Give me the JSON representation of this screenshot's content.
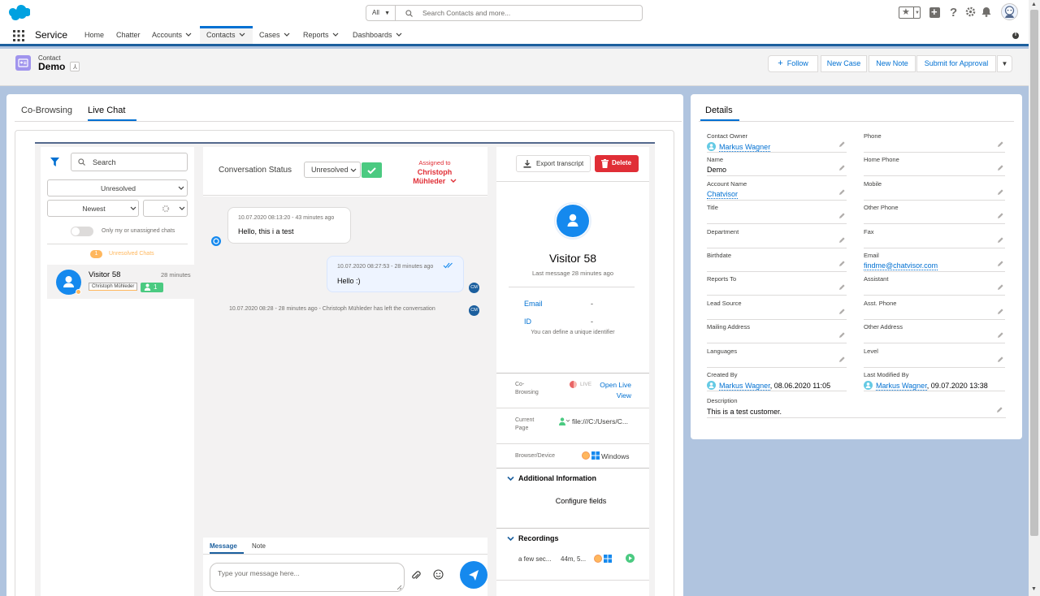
{
  "header": {
    "search_scope": "All",
    "search_placeholder": "Search Contacts and more..."
  },
  "nav": {
    "app_name": "Service",
    "items": [
      {
        "label": "Home"
      },
      {
        "label": "Chatter"
      },
      {
        "label": "Accounts"
      },
      {
        "label": "Contacts"
      },
      {
        "label": "Cases"
      },
      {
        "label": "Reports"
      },
      {
        "label": "Dashboards"
      }
    ]
  },
  "record": {
    "type": "Contact",
    "name": "Demo",
    "actions": {
      "follow": "Follow",
      "new_case": "New Case",
      "new_note": "New Note",
      "submit": "Submit for Approval"
    }
  },
  "tabs": {
    "cobrowsing": "Co-Browsing",
    "livechat": "Live Chat"
  },
  "chat_list": {
    "search_placeholder": "Search",
    "status_filter": "Unresolved",
    "sort": "Newest",
    "toggle_label": "Only my or unassigned chats",
    "unresolved_count": "1",
    "unresolved_label": "Unresolved Chats",
    "item": {
      "name": "Visitor 58",
      "time": "28 minutes",
      "agent": "Christoph Mühleder",
      "badge": "1"
    }
  },
  "conversation": {
    "status_label": "Conversation Status",
    "status_value": "Unresolved",
    "assigned_label": "Assigned to",
    "assigned_name_line1": "Christoph",
    "assigned_name_line2": "Mühleder",
    "messages": [
      {
        "time": "10.07.2020 08:13:20 - 43 minutes ago",
        "text": "Hello, this i a test"
      },
      {
        "time": "10.07.2020 08:27:53 - 28 minutes ago",
        "text": "Hello :)",
        "avatar": "CM"
      }
    ],
    "system_message": "10.07.2020 08:28 - 28 minutes ago - Christoph Mühleder has left the conversation",
    "system_avatar": "CM",
    "compose_tabs": {
      "message": "Message",
      "note": "Note"
    },
    "compose_placeholder": "Type your message here..."
  },
  "visitor": {
    "export_label": "Export transcript",
    "delete_label": "Delete",
    "name": "Visitor 58",
    "last_message": "Last message 28 minutes ago",
    "email_label": "Email",
    "email_value": "-",
    "id_label": "ID",
    "id_value": "-",
    "id_hint": "You can define a unique identifier",
    "cobrowsing_label_1": "Co-",
    "cobrowsing_label_2": "Browsing",
    "live_label": "LIVE",
    "open_live_1": "Open Live",
    "open_live_2": "View",
    "current_page_label_1": "Current",
    "current_page_label_2": "Page",
    "current_page_value": "file:///C:/Users/C...",
    "browser_label": "Browser/Device",
    "browser_value": "Windows",
    "additional_info": "Additional Information",
    "configure_fields": "Configure fields",
    "recordings": "Recordings",
    "rec_time": "a few sec...",
    "rec_duration": "44m, 5..."
  },
  "details": {
    "tab": "Details",
    "left": [
      {
        "label": "Contact Owner",
        "value": "Markus Wagner",
        "link": true,
        "avatar": true
      },
      {
        "label": "Name",
        "value": "Demo"
      },
      {
        "label": "Account Name",
        "value": "Chatvisor",
        "link": true
      },
      {
        "label": "Title",
        "value": ""
      },
      {
        "label": "Department",
        "value": ""
      },
      {
        "label": "Birthdate",
        "value": ""
      },
      {
        "label": "Reports To",
        "value": ""
      },
      {
        "label": "Lead Source",
        "value": ""
      },
      {
        "label": "Mailing Address",
        "value": ""
      },
      {
        "label": "Languages",
        "value": ""
      },
      {
        "label": "Created By",
        "value": "Markus Wagner",
        "suffix": ", 08.06.2020 11:05",
        "link": true,
        "avatar": true
      }
    ],
    "right": [
      {
        "label": "Phone",
        "value": ""
      },
      {
        "label": "Home Phone",
        "value": ""
      },
      {
        "label": "Mobile",
        "value": ""
      },
      {
        "label": "Other Phone",
        "value": ""
      },
      {
        "label": "Fax",
        "value": ""
      },
      {
        "label": "Email",
        "value": "findme@chatvisor.com",
        "link": true
      },
      {
        "label": "Assistant",
        "value": ""
      },
      {
        "label": "Asst. Phone",
        "value": ""
      },
      {
        "label": "Other Address",
        "value": ""
      },
      {
        "label": "Level",
        "value": ""
      },
      {
        "label": "Last Modified By",
        "value": "Markus Wagner",
        "suffix": ", 09.07.2020 13:38",
        "link": true,
        "avatar": true
      }
    ],
    "description_label": "Description",
    "description_value": "This is a test customer."
  },
  "colors": {
    "brand": "#0070d2",
    "success": "#4bca81",
    "danger": "#e02e36",
    "warning": "#ffb75d"
  }
}
